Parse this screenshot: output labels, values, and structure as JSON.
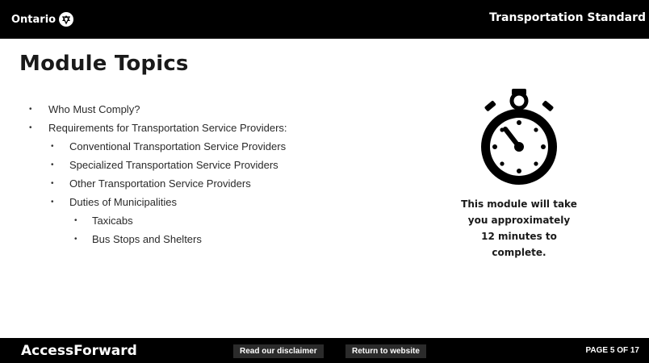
{
  "header": {
    "brand": "Ontario",
    "course_title": "Transportation Standard"
  },
  "main": {
    "heading": "Module Topics",
    "topics": [
      "Who Must Comply?",
      "Requirements for Transportation Service Providers:",
      "Conventional Transportation Service Providers",
      "Specialized Transportation Service Providers",
      "Other Transportation Service Providers",
      "Duties of Municipalities",
      "Taxicabs",
      "Bus Stops and Shelters"
    ],
    "timer_note": "This module will take\nyou approximately\n12 minutes to\ncomplete."
  },
  "footer": {
    "brand": "AccessForward",
    "disclaimer_label": "Read our disclaimer",
    "return_label": "Return to website",
    "page_indicator": "PAGE 5 OF 17"
  },
  "icons": {
    "brand_logo": "ontario-trillium-icon",
    "timer": "stopwatch-icon"
  },
  "colors": {
    "bar_background": "#000000",
    "button_background": "#2b2b2b",
    "text": "#1a1a1a"
  }
}
